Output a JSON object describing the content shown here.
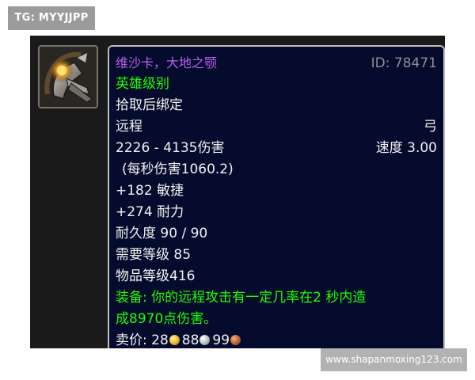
{
  "watermark_tag": "TG: MYYJJPP",
  "watermark_url": "www.shapanmoxing123.com",
  "item": {
    "icon": "crossbow-weapon-icon",
    "name": "维沙卡，大地之颚",
    "id_text": "ID: 78471",
    "difficulty": "英雄级别",
    "binding": "拾取后绑定",
    "slot": "远程",
    "weapon_type": "弓",
    "damage": "2226 - 4135伤害",
    "speed": "速度 3.00",
    "dps": "(每秒伤害1060.2)",
    "stat_agility": "+182 敏捷",
    "stat_stamina": "+274 耐力",
    "durability": "耐久度 90 / 90",
    "required_level": "需要等级 85",
    "item_level": "物品等级416",
    "equip_effect_line1": "装备:  你的远程攻击有一定几率在2 秒内造",
    "equip_effect_line2": "成8970点伤害。",
    "sell_price_label": "卖价: ",
    "sell_gold": "28",
    "sell_silver": "88",
    "sell_copper": "99"
  },
  "colors": {
    "tooltip_bg": "#050b2c",
    "name_purple": "#b660ec",
    "green": "#1eff00",
    "grey": "#8e8e8e",
    "text_white": "#f2f2f2"
  }
}
